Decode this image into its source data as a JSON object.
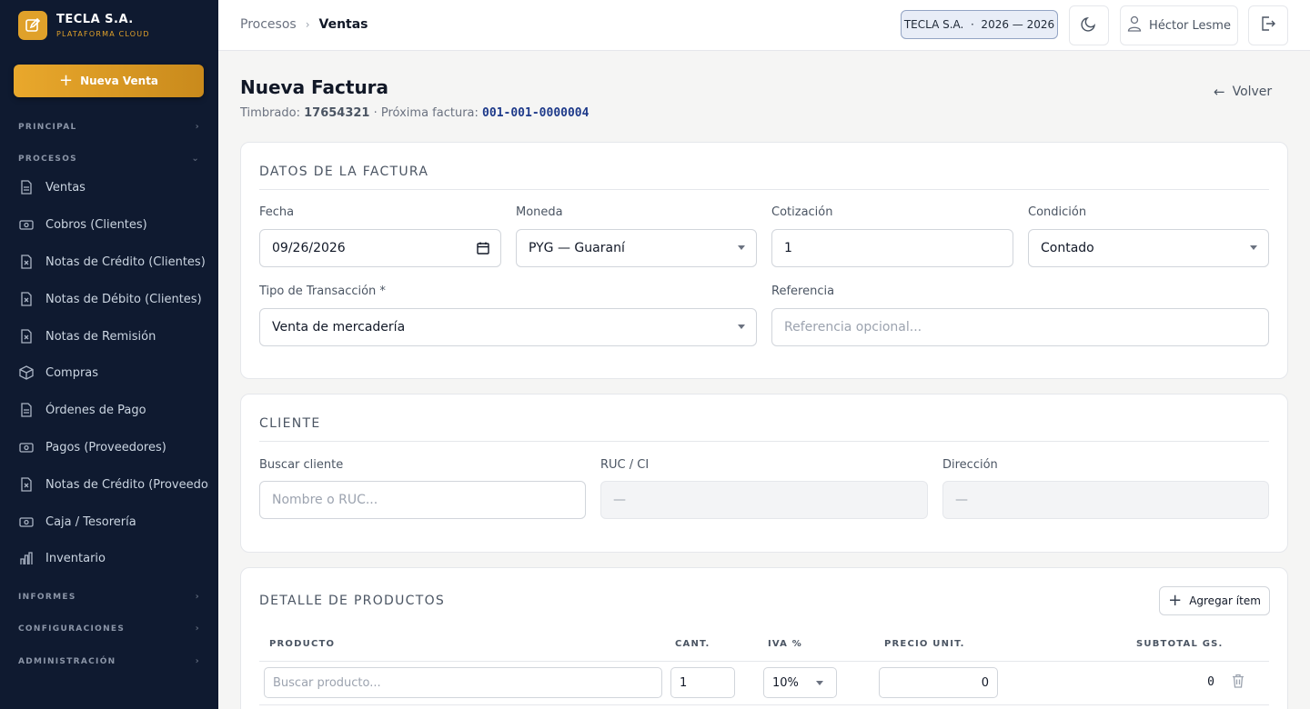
{
  "brand": {
    "name": "TECLA S.A.",
    "subtitle": "PLATAFORMA CLOUD",
    "accent": "#e0a12a"
  },
  "sidebar": {
    "new_sale_label": "Nueva Venta",
    "sections": {
      "principal": "PRINCIPAL",
      "procesos": "PROCESOS",
      "informes": "INFORMES",
      "configuraciones": "CONFIGURACIONES",
      "administracion": "ADMINISTRACIÓN"
    },
    "items": [
      {
        "label": "Ventas",
        "icon": "document-icon"
      },
      {
        "label": "Cobros (Clientes)",
        "icon": "cash-icon"
      },
      {
        "label": "Notas de Crédito (Clientes)",
        "icon": "receipt-icon"
      },
      {
        "label": "Notas de Débito (Clientes)",
        "icon": "receipt-icon"
      },
      {
        "label": "Notas de Remisión",
        "icon": "receipt-icon"
      },
      {
        "label": "Compras",
        "icon": "box-icon"
      },
      {
        "label": "Órdenes de Pago",
        "icon": "document-icon"
      },
      {
        "label": "Pagos (Proveedores)",
        "icon": "cash-icon"
      },
      {
        "label": "Notas de Crédito (Proveedores)",
        "icon": "receipt-icon"
      },
      {
        "label": "Caja / Tesorería",
        "icon": "cash-icon"
      },
      {
        "label": "Inventario",
        "icon": "bar-chart-icon"
      }
    ]
  },
  "topbar": {
    "breadcrumb": [
      "Procesos",
      "Ventas"
    ],
    "tenant": "TECLA S.A.  ·  2026 — 2026",
    "user": "Héctor Lesme"
  },
  "page": {
    "title": "Nueva Factura",
    "timbrado_label": "Timbrado:",
    "timbrado": "17654321",
    "next_label": "· Próxima factura:",
    "next_invoice": "001-001-0000004",
    "back_label": "Volver"
  },
  "invoice": {
    "title": "DATOS DE LA FACTURA",
    "fecha_label": "Fecha",
    "fecha": "09/26/2026",
    "moneda_label": "Moneda",
    "moneda": "PYG — Guaraní",
    "cotizacion_label": "Cotización",
    "cotizacion": "1",
    "condicion_label": "Condición",
    "condicion": "Contado",
    "tipo_label": "Tipo de Transacción *",
    "tipo": "Venta de mercadería",
    "referencia_label": "Referencia",
    "referencia_placeholder": "Referencia opcional..."
  },
  "client": {
    "title": "CLIENTE",
    "search_label": "Buscar cliente",
    "search_placeholder": "Nombre o RUC...",
    "ruc_label": "RUC / CI",
    "ruc": "—",
    "address_label": "Dirección",
    "address": "—"
  },
  "products": {
    "title": "DETALLE DE PRODUCTOS",
    "add_label": "Agregar ítem",
    "headers": [
      "PRODUCTO",
      "CANT.",
      "IVA %",
      "PRECIO UNIT.",
      "SUBTOTAL GS."
    ],
    "row": {
      "product_placeholder": "Buscar producto...",
      "qty": "1",
      "iva": "10%",
      "price": "0",
      "subtotal": "0"
    }
  }
}
